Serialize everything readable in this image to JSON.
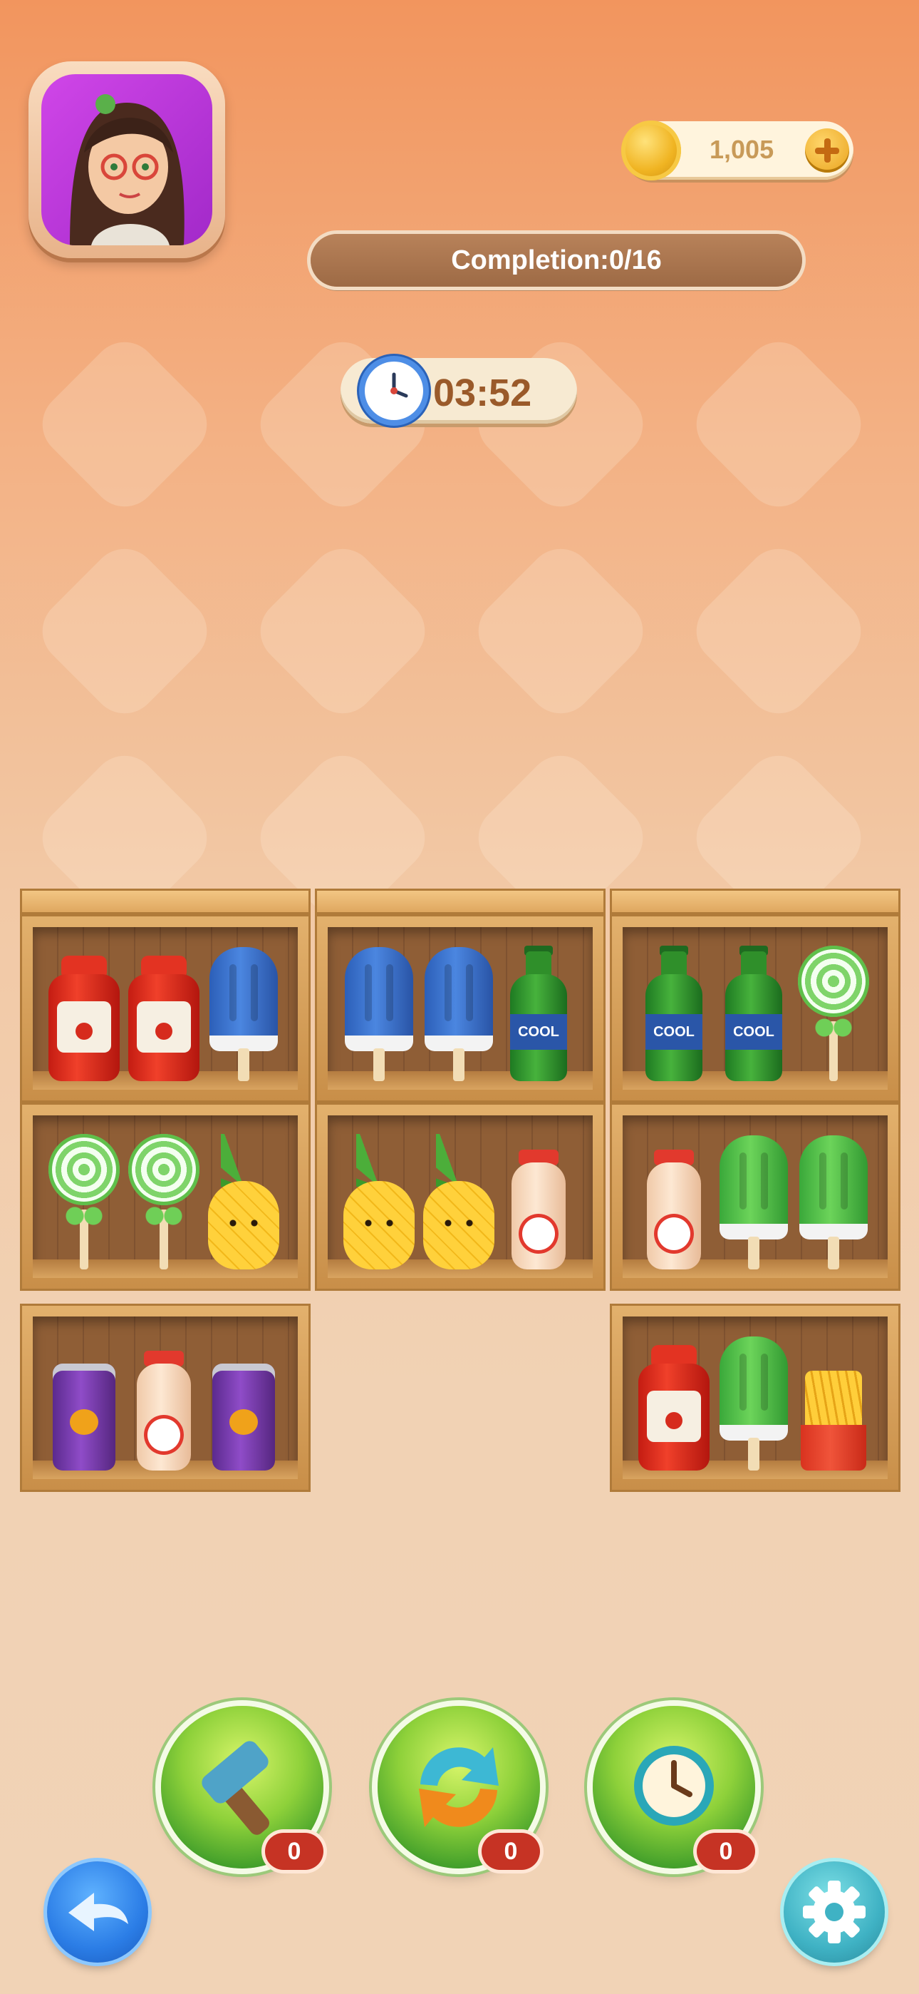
{
  "header": {
    "coins": "1,005",
    "completion_text": "Completion:0/16",
    "timer": "03:52"
  },
  "power_ups": {
    "hammer_count": "0",
    "shuffle_count": "0",
    "time_count": "0"
  },
  "colors": {
    "accent_orange": "#f2955e",
    "badge_red": "#c63324",
    "completion_bar": "#9d6a45"
  },
  "icons": [
    "avatar",
    "coin-icon",
    "plus-icon",
    "clock-icon",
    "hammer-icon",
    "shuffle-icon",
    "time-icon",
    "back-arrow-icon",
    "gear-icon"
  ],
  "shelves": {
    "row1_left": [
      "ketchup",
      "ketchup",
      "blue-popsicle"
    ],
    "row1_mid": [
      "blue-popsicle",
      "blue-popsicle",
      "soda"
    ],
    "row1_right": [
      "soda",
      "soda",
      "lollipop"
    ],
    "row2_left": [
      "lollipop",
      "lollipop",
      "pineapple"
    ],
    "row2_mid": [
      "pineapple",
      "pineapple",
      "yakult"
    ],
    "row2_right": [
      "yakult",
      "green-popsicle",
      "green-popsicle"
    ],
    "row3_left": [
      "grape-can",
      "yakult",
      "grape-can"
    ],
    "row3_right": [
      "ketchup",
      "green-popsicle",
      "fries"
    ]
  },
  "item_labels": {
    "soda_label": "COOL"
  }
}
